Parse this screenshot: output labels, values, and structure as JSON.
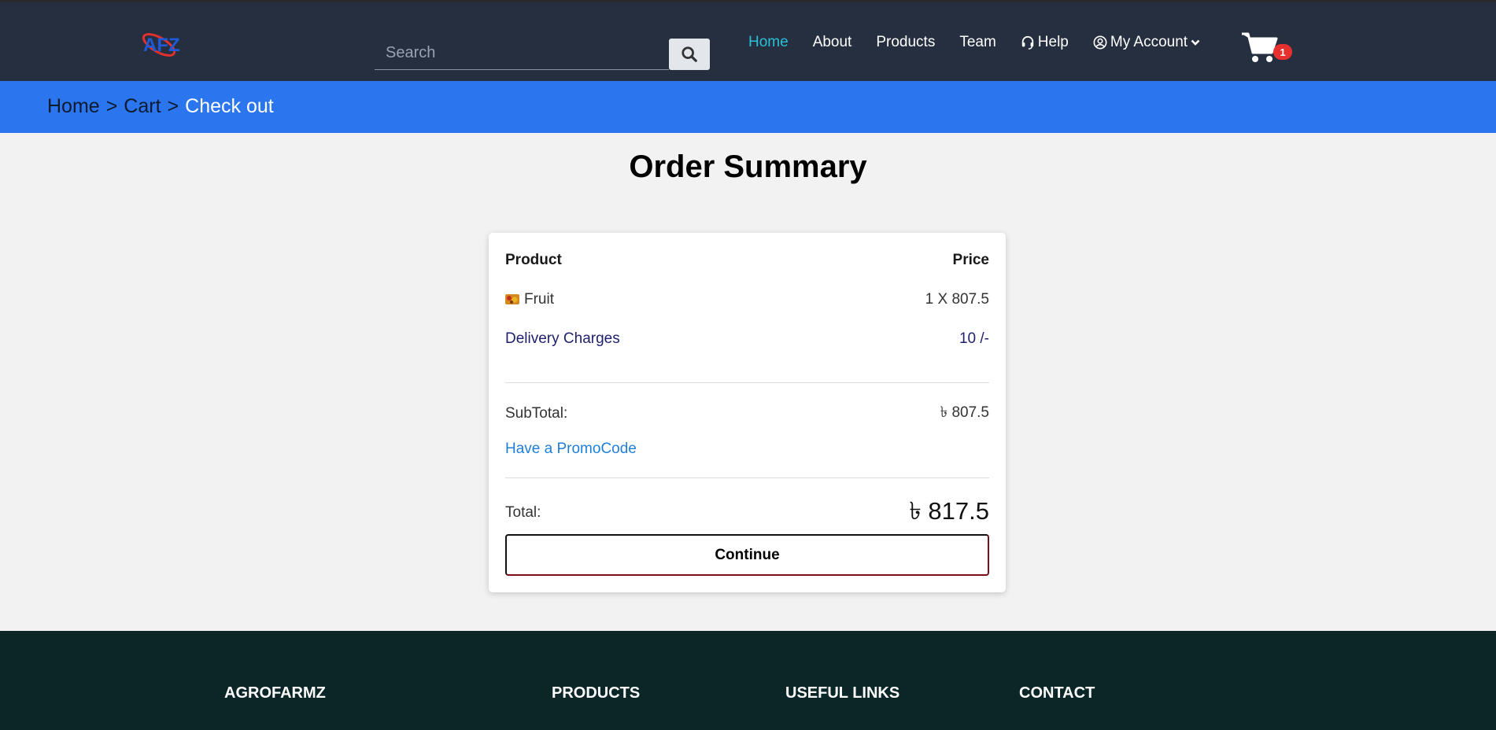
{
  "brand": {
    "logo_text": "AFZ",
    "accent": "#2bc0d8",
    "logo_red": "#e0302f",
    "logo_blue": "#1e5ad8"
  },
  "header": {
    "search": {
      "placeholder": "Search"
    },
    "nav": [
      {
        "label": "Home",
        "active": true
      },
      {
        "label": "About"
      },
      {
        "label": "Products"
      },
      {
        "label": "Team"
      },
      {
        "label": "Help",
        "icon": "headset-icon"
      },
      {
        "label": "My Account",
        "icon": "user-circle-icon"
      }
    ],
    "cart_count": "1"
  },
  "breadcrumb": {
    "items": [
      "Home",
      "Cart"
    ],
    "separator": ">",
    "current": "Check out"
  },
  "page": {
    "title": "Order Summary"
  },
  "summary": {
    "header": {
      "product": "Product",
      "price": "Price"
    },
    "item": {
      "name": "Fruit",
      "price": "1 X 807.5"
    },
    "delivery": {
      "label": "Delivery Charges",
      "value": "10 /-"
    },
    "subtotal": {
      "label": "SubTotal:",
      "value": "৳ 807.5"
    },
    "promo_label": "Have a PromoCode",
    "total": {
      "label": "Total:",
      "value": "৳ 817.5"
    },
    "continue_label": "Continue"
  },
  "footer": {
    "columns": [
      "AGROFARMZ",
      "PRODUCTS",
      "USEFUL LINKS",
      "CONTACT"
    ]
  }
}
